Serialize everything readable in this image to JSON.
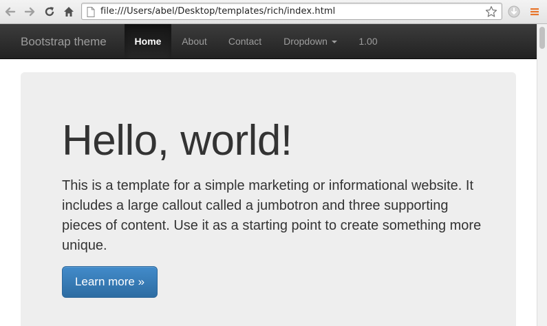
{
  "browser": {
    "back_icon": "arrow-left-icon",
    "forward_icon": "arrow-right-icon",
    "reload_icon": "reload-icon",
    "home_icon": "home-icon",
    "page_icon": "page-icon",
    "url": "file:///Users/abel/Desktop/templates/rich/index.html",
    "bookmark_icon": "star-icon",
    "extension_icon": "download-extension-icon",
    "menu_icon": "menu-icon"
  },
  "navbar": {
    "brand": "Bootstrap theme",
    "items": [
      {
        "label": "Home",
        "active": true
      },
      {
        "label": "About",
        "active": false
      },
      {
        "label": "Contact",
        "active": false
      },
      {
        "label": "Dropdown",
        "active": false,
        "has_caret": true
      },
      {
        "label": "1.00",
        "active": false
      }
    ]
  },
  "jumbotron": {
    "heading": "Hello, world!",
    "text": "This is a template for a simple marketing or informational website. It includes a large callout called a jumbotron and three supporting pieces of content. Use it as a starting point to create something more unique.",
    "button_label": "Learn more »"
  },
  "colors": {
    "navbar_bg": "#222222",
    "navbar_text": "#9d9d9d",
    "jumbotron_bg": "#eeeeee",
    "primary_button": "#428bca",
    "menu_icon": "#e8742a"
  }
}
